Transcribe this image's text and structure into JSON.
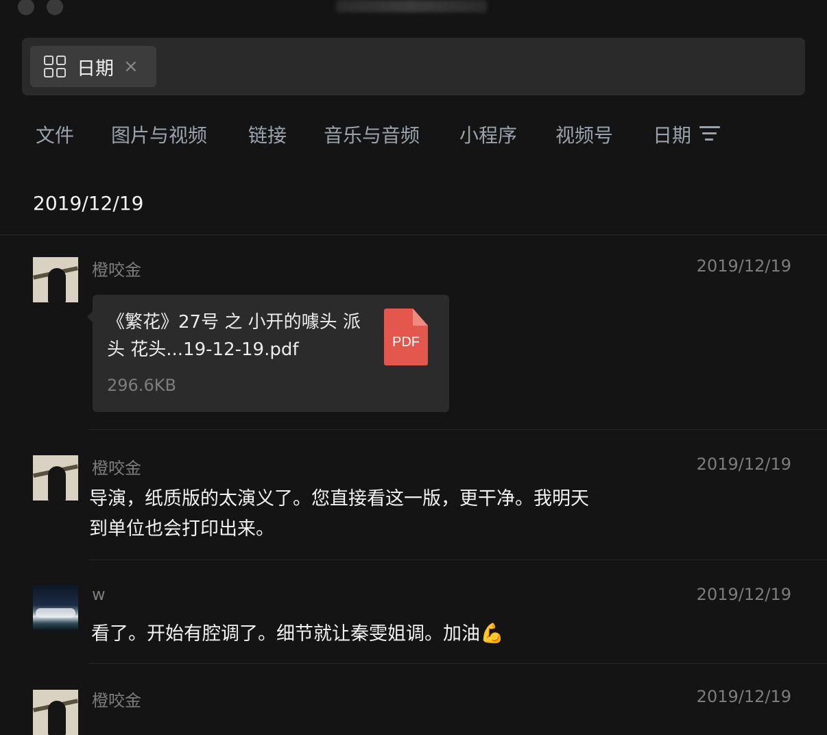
{
  "search": {
    "chip_label": "日期",
    "chip_close": "×"
  },
  "tabs": [
    "文件",
    "图片与视频",
    "链接",
    "音乐与音频",
    "小程序",
    "视频号",
    "日期"
  ],
  "date_header": "2019/12/19",
  "messages": [
    {
      "sender": "橙咬金",
      "time": "2019/12/19",
      "file": {
        "name": "《繁花》27号 之 小开的噱头 派头 花头...19-12-19.pdf",
        "size": "296.6KB",
        "badge": "PDF"
      }
    },
    {
      "sender": "橙咬金",
      "time": "2019/12/19",
      "text_line1": "导演，纸质版的太演义了。您直接看这一版，更干净。我明天",
      "text_line2": "到单位也会打印出来。"
    },
    {
      "sender": "w",
      "time": "2019/12/19",
      "text": "看了。开始有腔调了。细节就让秦雯姐调。加油",
      "emoji": "💪"
    },
    {
      "sender": "橙咬金",
      "time": "2019/12/19"
    }
  ],
  "colors": {
    "background": "#141414",
    "tab_text": "#9aa3ad",
    "pdf_red": "#e4574c"
  }
}
